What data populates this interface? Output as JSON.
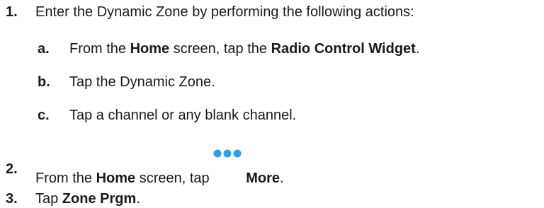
{
  "steps": [
    {
      "number": "1.",
      "text": "Enter the Dynamic Zone by performing the following actions:",
      "substeps": [
        {
          "letter": "a.",
          "prefix": "From the ",
          "bold1": "Home",
          "middle": " screen, tap the ",
          "bold2": "Radio Control Widget",
          "suffix": "."
        },
        {
          "letter": "b.",
          "text": "Tap the Dynamic Zone."
        },
        {
          "letter": "c.",
          "text": "Tap a channel or any blank channel."
        }
      ]
    },
    {
      "number": "2.",
      "prefix": "From the ",
      "bold1": "Home",
      "middle": " screen, tap ",
      "icon": "more-dots-icon",
      "bold2": "More",
      "suffix": "."
    },
    {
      "number": "3.",
      "prefix": "Tap ",
      "bold1": "Zone Prgm",
      "suffix": "."
    }
  ],
  "colors": {
    "text": "#1a1a1a",
    "icon_dots": "#2aa0e8"
  }
}
